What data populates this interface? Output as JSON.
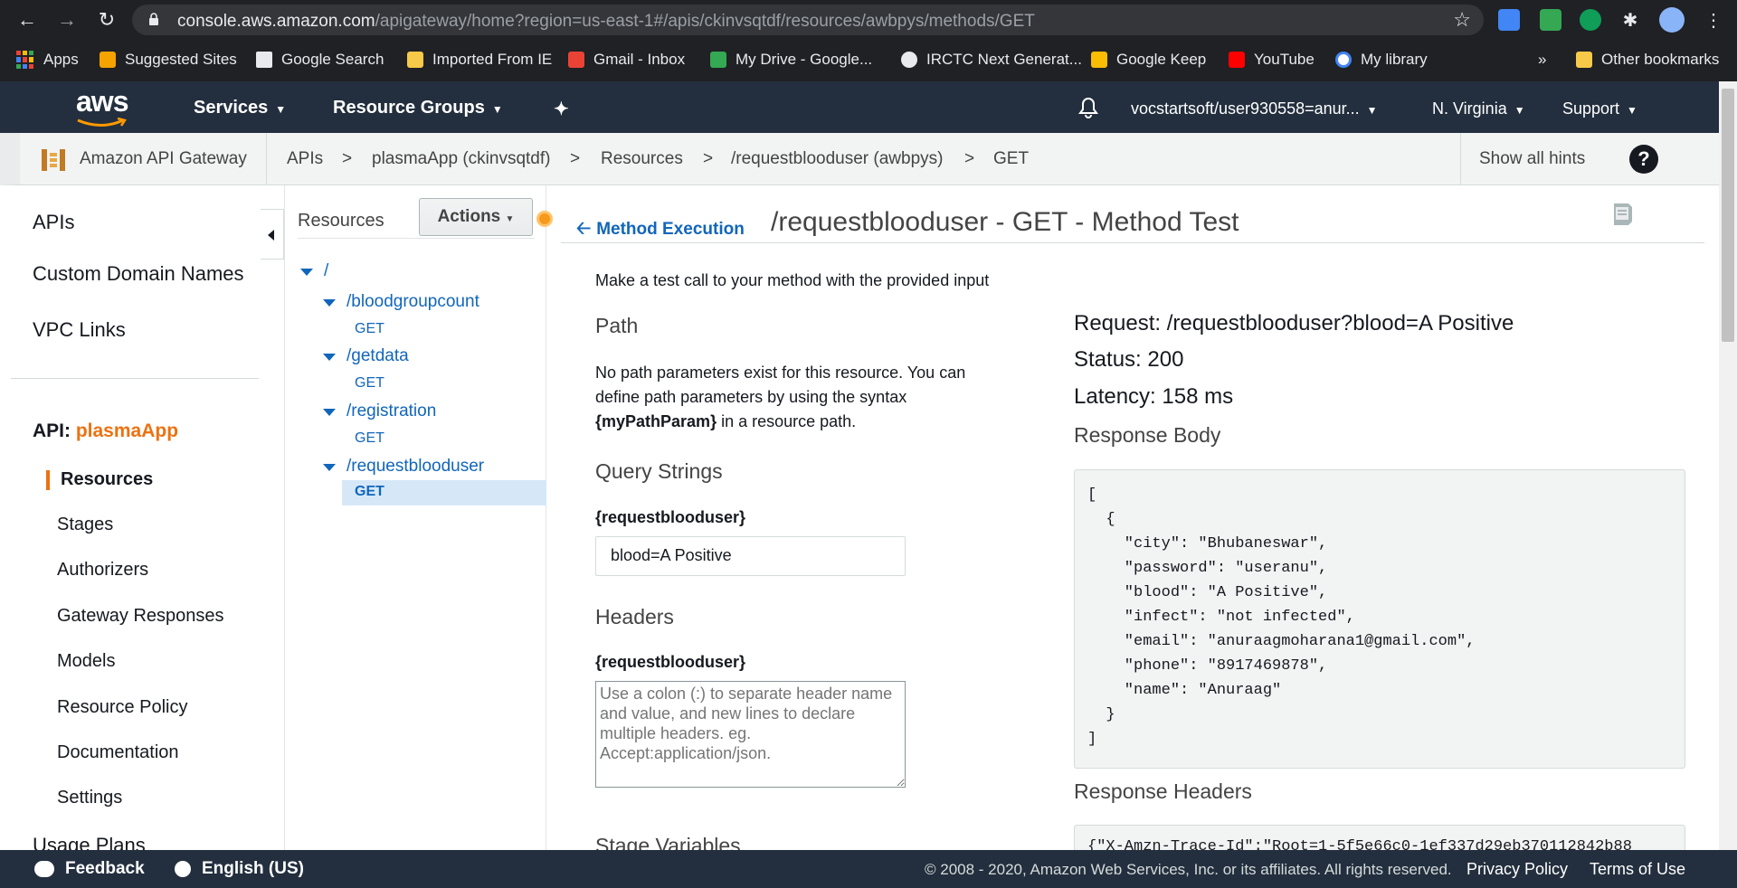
{
  "browser": {
    "url_host": "console.aws.amazon.com",
    "url_path": "/apigateway/home?region=us-east-1#/apis/ckinvsqtdf/resources/awbpys/methods/GET",
    "bookmarks": [
      {
        "label": "Apps",
        "color": "#ea4335"
      },
      {
        "label": "Suggested Sites",
        "color": "#f4a300"
      },
      {
        "label": "Google Search",
        "color": "#e8eaed"
      },
      {
        "label": "Imported From IE",
        "color": "#f7c948"
      },
      {
        "label": "Gmail - Inbox",
        "color": "#ea4335"
      },
      {
        "label": "My Drive - Google...",
        "color": "#34a853"
      },
      {
        "label": "IRCTC Next Generat...",
        "color": "#e8eaed"
      },
      {
        "label": "Google Keep",
        "color": "#fbbc04"
      },
      {
        "label": "YouTube",
        "color": "#ff0000"
      },
      {
        "label": "My library",
        "color": "#4285f4"
      }
    ],
    "more_bookmarks": "»",
    "other_bookmarks": "Other bookmarks"
  },
  "aws_nav": {
    "logo": "aws",
    "services": "Services",
    "resource_groups": "Resource Groups",
    "account": "vocstartsoft/user930558=anur...",
    "region": "N. Virginia",
    "support": "Support"
  },
  "breadcrumb": {
    "service": "Amazon API Gateway",
    "items": [
      "APIs",
      "plasmaApp (ckinvsqtdf)",
      "Resources",
      "/requestblooduser (awbpys)",
      "GET"
    ],
    "separator": ">",
    "show_hints": "Show all hints",
    "help": "?"
  },
  "left_nav": {
    "top_items": [
      "APIs",
      "Custom Domain Names",
      "VPC Links"
    ],
    "api_prefix": "API:",
    "api_name": "plasmaApp",
    "sub_items": [
      "Resources",
      "Stages",
      "Authorizers",
      "Gateway Responses",
      "Models",
      "Resource Policy",
      "Documentation",
      "Settings"
    ],
    "bottom_item": "Usage Plans"
  },
  "resources_panel": {
    "title": "Resources",
    "actions": "Actions",
    "root": "/",
    "tree": [
      {
        "path": "/bloodgroupcount",
        "method": "GET"
      },
      {
        "path": "/getdata",
        "method": "GET"
      },
      {
        "path": "/registration",
        "method": "GET"
      },
      {
        "path": "/requestblooduser",
        "method": "GET"
      }
    ]
  },
  "method_test": {
    "back_link": "Method Execution",
    "title": "/requestblooduser - GET - Method Test",
    "intro": "Make a test call to your method with the provided input",
    "path_heading": "Path",
    "path_text_1": "No path parameters exist for this resource. You can",
    "path_text_2": "define path parameters by using the syntax",
    "path_param": "{myPathParam}",
    "path_text_3": " in a resource path.",
    "query_heading": "Query Strings",
    "query_label": "{requestblooduser}",
    "query_value": "blood=A Positive",
    "headers_heading": "Headers",
    "headers_label": "{requestblooduser}",
    "headers_placeholder": "Use a colon (:) to separate header name and value, and new lines to declare multiple headers. eg. Accept:application/json.",
    "stage_heading": "Stage Variables"
  },
  "result": {
    "request": "Request: /requestblooduser?blood=A Positive",
    "status": "Status: 200",
    "latency": "Latency: 158 ms",
    "body_heading": "Response Body",
    "body_lines": [
      "[",
      "  {",
      "    \"city\": \"Bhubaneswar\",",
      "    \"password\": \"useranu\",",
      "    \"blood\": \"A Positive\",",
      "    \"infect\": \"not infected\",",
      "    \"email\": \"anuraagmoharana1@gmail.com\",",
      "    \"phone\": \"8917469878\",",
      "    \"name\": \"Anuraag\"",
      "  }",
      "]"
    ],
    "headers_heading": "Response Headers",
    "headers_preview": "{\"X-Amzn-Trace-Id\":\"Root=1-5f5e66c0-1ef337d29eb370112842b88"
  },
  "footer": {
    "feedback": "Feedback",
    "language": "English (US)",
    "copyright": "© 2008 - 2020, Amazon Web Services, Inc. or its affiliates. All rights reserved.",
    "privacy": "Privacy Policy",
    "terms": "Terms of Use"
  }
}
